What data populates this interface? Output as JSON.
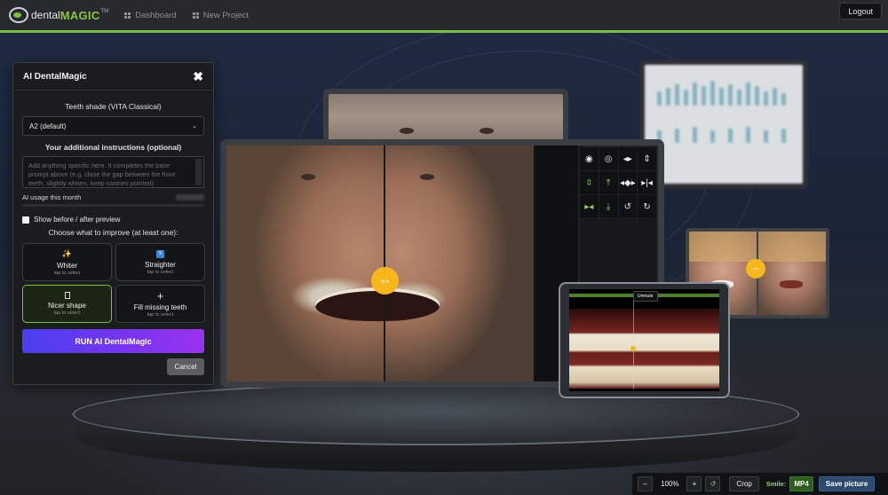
{
  "topbar": {
    "logo_text_1": "dental",
    "logo_text_2": "MAGIC",
    "logo_tm": "TM",
    "nav": [
      {
        "label": "Dashboard",
        "icon": "grid-icon"
      },
      {
        "label": "New Project",
        "icon": "grid-icon"
      }
    ],
    "logout_label": "Logout",
    "accent_color": "#7ac143"
  },
  "ai_panel": {
    "title": "AI DentalMagic",
    "close_glyph": "✖",
    "shade_label": "Teeth shade (VITA Classical)",
    "shade_value": "A2 (default)",
    "instructions_label": "Your additional instructions (optional)",
    "instructions_placeholder": "Add anything specific here. It completes the base prompt above (e.g. close the gap between the front teeth, slightly whiten, keep canines pointed)",
    "usage_label": "AI usage this month",
    "preview_label": "Show before / after preview",
    "choose_label": "Choose what to improve (at least one):",
    "options": [
      {
        "name": "Whiter",
        "sub": "tap to select",
        "icon": "sparkle-icon",
        "selected": false
      },
      {
        "name": "Straighter",
        "sub": "tap to select",
        "icon": "align-icon",
        "selected": false
      },
      {
        "name": "Nicer shape",
        "sub": "tap to select",
        "icon": "tooth-shape-icon",
        "selected": true
      },
      {
        "name": "Fill missing teeth",
        "sub": "tap to select",
        "icon": "plus-icon",
        "selected": false
      }
    ],
    "run_label": "RUN AI DentalMagic",
    "cancel_label": "Cancel"
  },
  "viewer": {
    "swap_glyph": "⇔",
    "tablet_unmute": "Unmute",
    "tools": [
      [
        "eye-open-icon",
        "eye-icon",
        "flip-horizontal-icon",
        "move-vertical-icon"
      ],
      [
        "expand-vertical-icon",
        "compress-vertical-icon",
        "expand-horizontal-icon",
        "compress-horizontal-icon"
      ],
      [
        "stretch-icon",
        "shrink-icon",
        "rotate-left-icon",
        "rotate-right-icon"
      ]
    ]
  },
  "bottombar": {
    "minus": "–",
    "zoom": "100%",
    "plus": "+",
    "reset_glyph": "↺",
    "crop_label": "Crop",
    "smile_label": "Smile:",
    "mp4_label": "MP4",
    "save_label": "Save picture"
  }
}
